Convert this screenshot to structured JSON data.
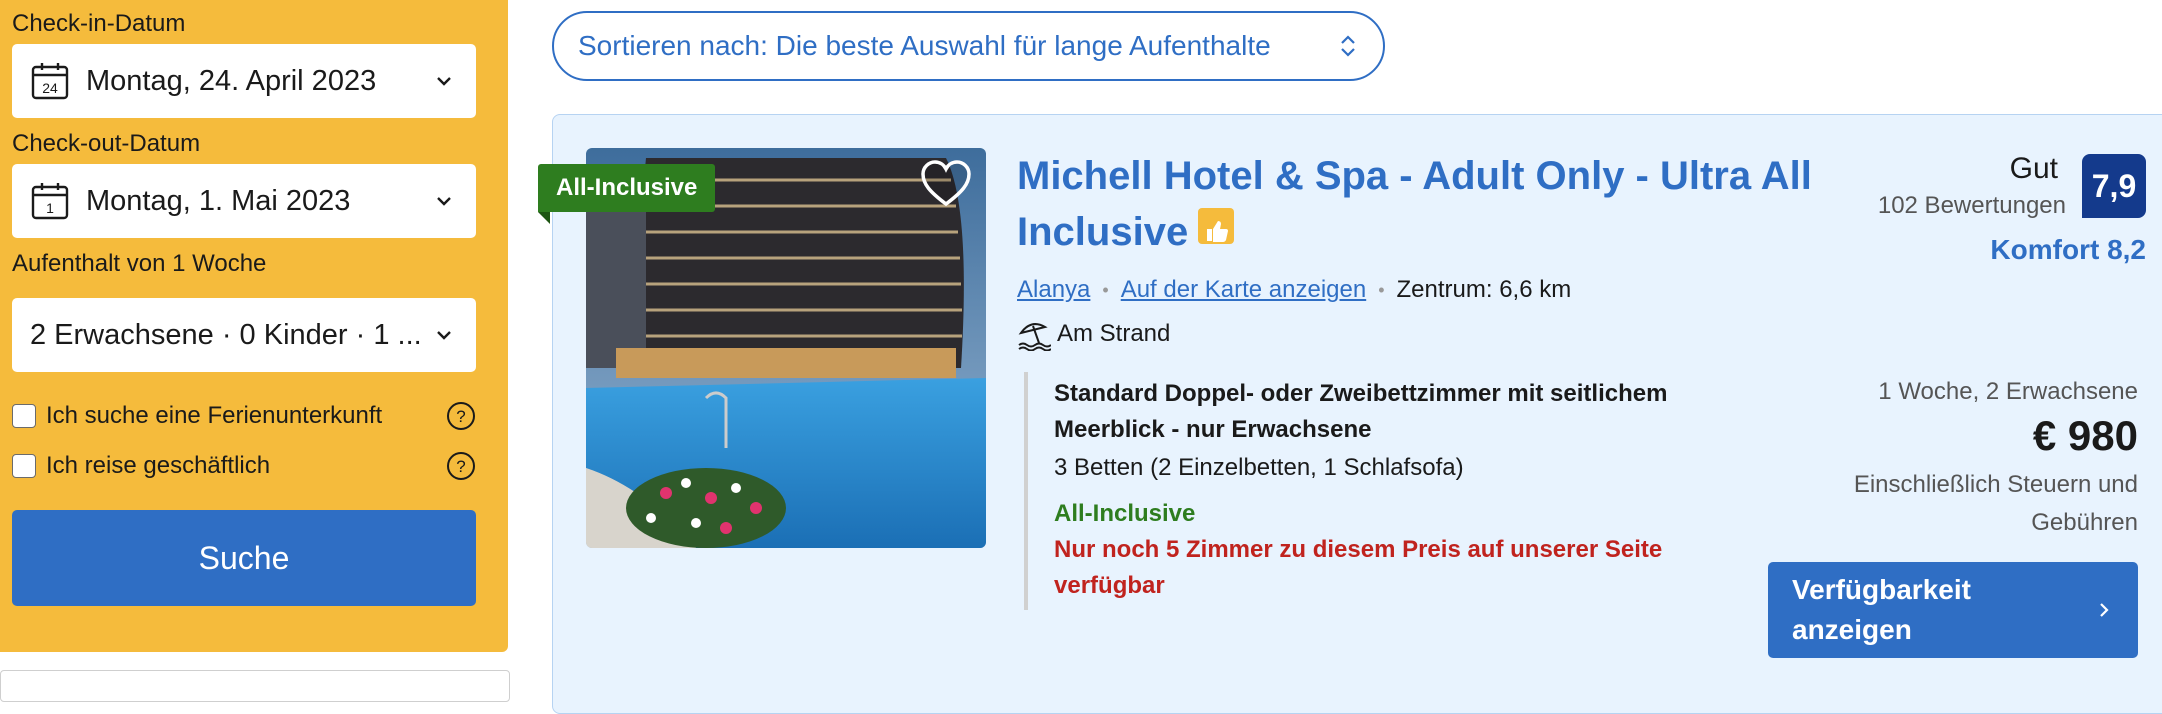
{
  "sidebar": {
    "checkin_label": "Check-in-Datum",
    "checkin_value": "Montag, 24. April 2023",
    "checkin_icon_day": "24",
    "checkout_label": "Check-out-Datum",
    "checkout_value": "Montag, 1. Mai 2023",
    "checkout_icon_day": "1",
    "stay_length": "Aufenthalt von 1 Woche",
    "guests_value": "2 Erwachsene · 0 Kinder · 1 ...",
    "checkbox_vacation": "Ich suche eine Ferienunterkunft",
    "checkbox_business": "Ich reise geschäftlich",
    "search_button": "Suche"
  },
  "sort": {
    "label": "Sortieren nach: Die beste Auswahl für lange Aufenthalte"
  },
  "hotel": {
    "badge": "All-Inclusive",
    "name": "Michell Hotel & Spa - Adult Only - Ultra All Inclusive",
    "city_link": "Alanya",
    "map_link": "Auf der Karte anzeigen",
    "distance": "Zentrum: 6,6 km",
    "beach": "Am Strand",
    "room_title": "Standard Doppel- oder Zweibettzimmer mit seitlichem Meerblick - nur Erwachsene",
    "room_beds": "3 Betten (2 Einzelbetten, 1 Schlafsofa)",
    "room_board": "All-Inclusive",
    "room_warning": "Nur noch 5 Zimmer zu diesem Preis auf unserer Seite verfügbar",
    "rating_word": "Gut",
    "rating_count": "102 Bewertungen",
    "score": "7,9",
    "comfort": "Komfort 8,2",
    "stay_info": "1 Woche, 2 Erwachsene",
    "price": "€ 980",
    "tax_note": "Einschließlich Steuern und Gebühren",
    "availability_button": "Verfügbarkeit anzeigen"
  },
  "colors": {
    "sidebar_bg": "#f5bb3c",
    "primary_blue": "#2f6ec4",
    "score_bg": "#143a8c",
    "green": "#2e7d1f",
    "red": "#c0231e",
    "card_bg": "#e8f3fe"
  }
}
